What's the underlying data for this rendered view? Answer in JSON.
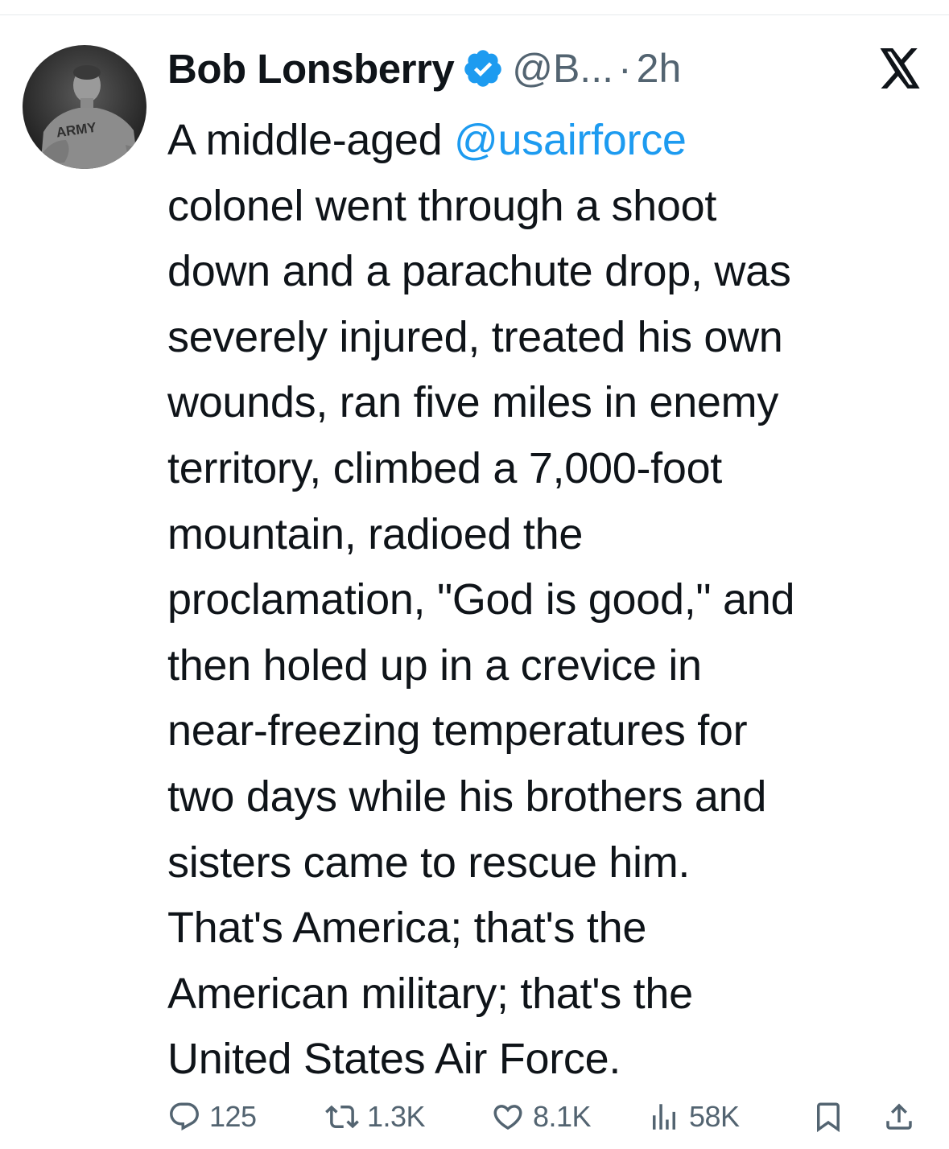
{
  "tweet": {
    "author": {
      "name": "Bob Lonsberry",
      "handle": "@B...",
      "avatar_text": "ARMY"
    },
    "separator": "·",
    "timestamp": "2h",
    "body": {
      "line1_prefix": "A middle-aged ",
      "mention": "@usairforce",
      "lines": [
        "colonel went through a shoot",
        "down and a parachute drop, was",
        "severely injured, treated his own",
        "wounds, ran five miles in enemy",
        "territory, climbed a 7,000-foot",
        "mountain, radioed the",
        "proclamation, \"God is good,\" and",
        "then holed up in a crevice in",
        "near-freezing temperatures for",
        "two days while his brothers and",
        "sisters came to rescue him.",
        "That's America; that's the",
        "American military; that's the",
        "United States Air Force."
      ]
    },
    "stats": {
      "replies": "125",
      "reposts": "1.3K",
      "likes": "8.1K",
      "views": "58K"
    }
  },
  "icons": {
    "verified": "verified-badge-icon",
    "platform": "x-logo-icon",
    "reply": "reply-icon",
    "repost": "repost-icon",
    "like": "heart-icon",
    "views": "views-icon",
    "bookmark": "bookmark-icon",
    "share": "share-icon"
  },
  "colors": {
    "text": "#0f1419",
    "secondary": "#536471",
    "accent": "#1d9bf0"
  }
}
